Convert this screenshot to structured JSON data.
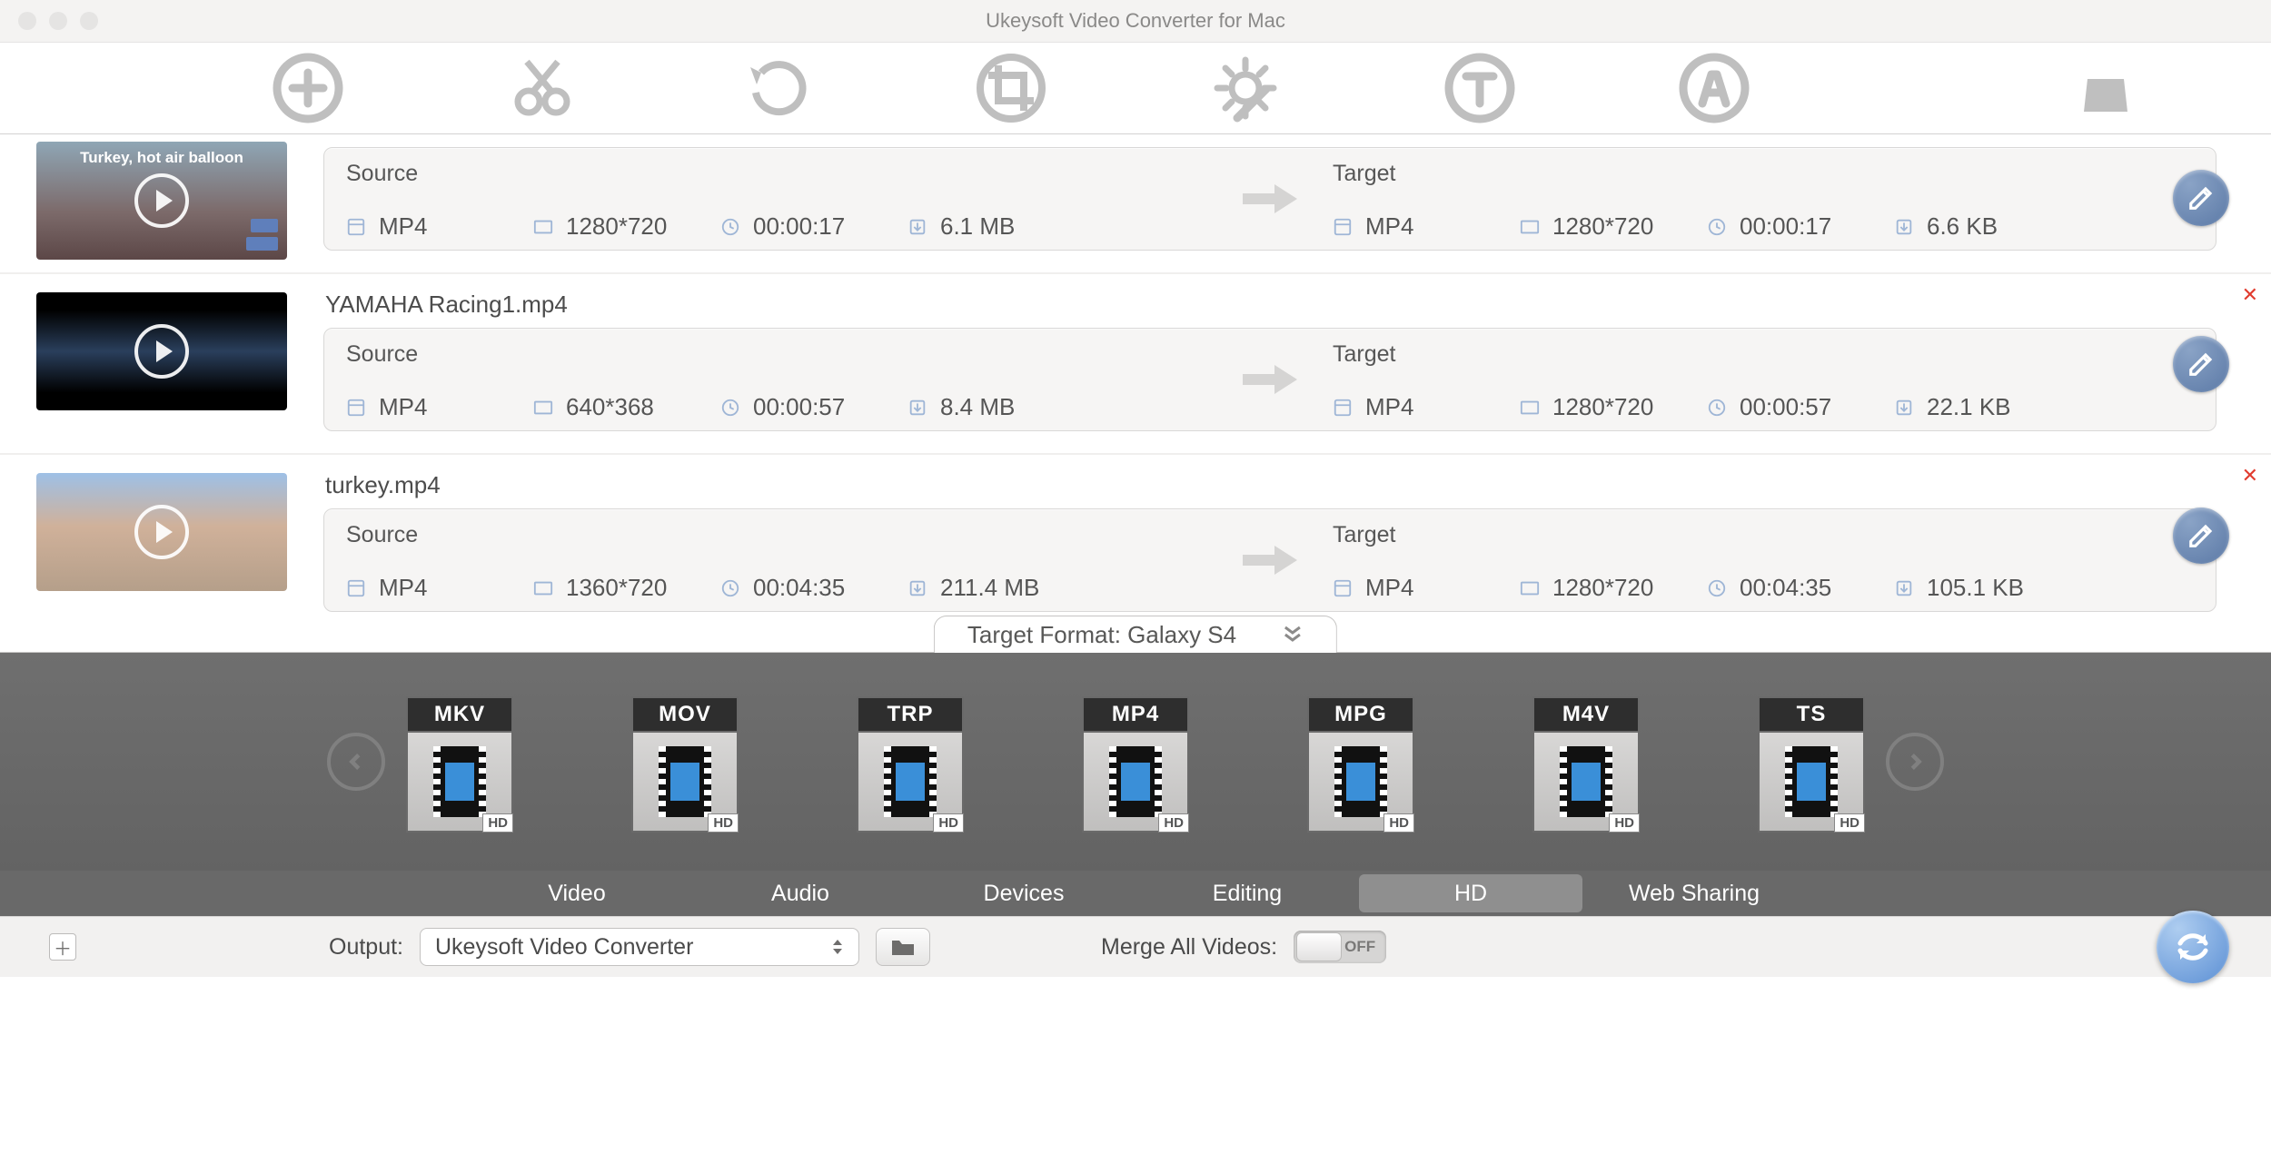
{
  "app": {
    "title": "Ukeysoft Video Converter for Mac"
  },
  "toolbar_icons": [
    "add",
    "cut",
    "rotate",
    "crop",
    "effects",
    "text",
    "watermark",
    "shop"
  ],
  "target_format": {
    "label": "Target Format: Galaxy S4"
  },
  "videos": [
    {
      "filename": "",
      "thumb_caption": "Turkey, hot air balloon",
      "source": {
        "heading": "Source",
        "format": "MP4",
        "resolution": "1280*720",
        "duration": "00:00:17",
        "size": "6.1 MB"
      },
      "target": {
        "heading": "Target",
        "format": "MP4",
        "resolution": "1280*720",
        "duration": "00:00:17",
        "size": "6.6 KB"
      }
    },
    {
      "filename": "YAMAHA Racing1.mp4",
      "thumb_caption": "",
      "source": {
        "heading": "Source",
        "format": "MP4",
        "resolution": "640*368",
        "duration": "00:00:57",
        "size": "8.4 MB"
      },
      "target": {
        "heading": "Target",
        "format": "MP4",
        "resolution": "1280*720",
        "duration": "00:00:57",
        "size": "22.1 KB"
      }
    },
    {
      "filename": "turkey.mp4",
      "thumb_caption": "",
      "source": {
        "heading": "Source",
        "format": "MP4",
        "resolution": "1360*720",
        "duration": "00:04:35",
        "size": "211.4 MB"
      },
      "target": {
        "heading": "Target",
        "format": "MP4",
        "resolution": "1280*720",
        "duration": "00:04:35",
        "size": "105.1 KB"
      }
    }
  ],
  "formats": [
    "MKV",
    "MOV",
    "TRP",
    "MP4",
    "MPG",
    "M4V",
    "TS"
  ],
  "tabs": {
    "items": [
      "Video",
      "Audio",
      "Devices",
      "Editing",
      "HD",
      "Web Sharing"
    ],
    "active": "HD"
  },
  "footer": {
    "output_label": "Output:",
    "output_value": "Ukeysoft Video Converter",
    "merge_label": "Merge All Videos:",
    "merge_state": "OFF"
  }
}
